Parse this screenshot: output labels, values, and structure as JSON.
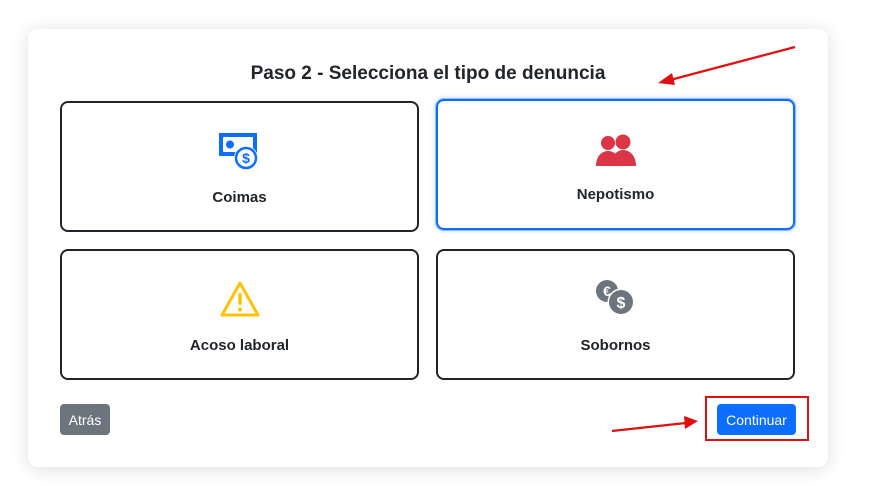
{
  "title": "Paso 2 - Selecciona el tipo de denuncia",
  "options": [
    {
      "label": "Coimas",
      "icon": "money-bill-coin-icon",
      "color": "#0d6efd",
      "selected": false
    },
    {
      "label": "Nepotismo",
      "icon": "users-icon",
      "color": "#dc3545",
      "selected": true
    },
    {
      "label": "Acoso laboral",
      "icon": "warning-triangle-icon",
      "color": "#ffc107",
      "selected": false
    },
    {
      "label": "Sobornos",
      "icon": "coins-euro-dollar-icon",
      "color": "#6c757d",
      "selected": false
    }
  ],
  "buttons": {
    "back_label": "Atrás",
    "continue_label": "Continuar"
  },
  "colors": {
    "primary": "#0d6efd",
    "secondary": "#6c757d",
    "annotation": "#e01010"
  }
}
